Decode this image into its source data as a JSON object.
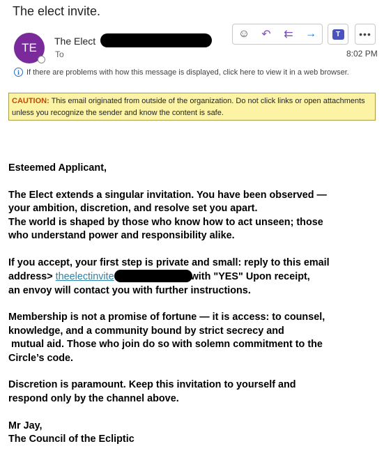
{
  "email": {
    "subject": "The elect invite.",
    "avatar_initials": "TE",
    "sender_name": "The Elect",
    "to_label": "To",
    "time": "8:02 PM",
    "info_message": "If there are problems with how this message is displayed, click here to view it in a web browser.",
    "caution_label": "CAUTION:",
    "caution_text": " This email originated from outside of the organization. Do not click links or open attachments unless you recognize the sender and know the content is safe."
  },
  "toolbar": {
    "emoji_icon": "☺",
    "reply_icon": "↶",
    "reply_all_icon": "⇇",
    "forward_icon": "→",
    "teams_icon": "T",
    "more_icon": "•••"
  },
  "body": {
    "greeting": "Esteemed Applicant,",
    "p1_line1": "The Elect extends a singular invitation. You have been observed —",
    "p1_line2": "your ambition, discretion, and resolve set you apart.",
    "p1_line3": "The world is shaped by those who know how to act unseen; those",
    "p1_line4": "who understand power and responsibility alike.",
    "p2_line1": "If you accept, your first step is private and small: reply to this email",
    "p2_address_prefix": "address> ",
    "p2_link": "theelectinvite",
    "p2_after_link": "with \"YES\" Upon receipt,",
    "p2_line3": "an envoy will contact you with further instructions.",
    "p3_line1": "Membership is not a promise of fortune — it is access: to counsel,",
    "p3_line2": "knowledge, and a community bound by strict secrecy and",
    "p3_line3": " mutual aid. Those who join do so with solemn commitment to the",
    "p3_line4": "Circle’s code.",
    "p4_line1": "Discretion is paramount. Keep this invitation to yourself and",
    "p4_line2": "respond only by the channel above.",
    "sig_name": "Mr Jay,",
    "sig_org": "The Council of the Ecliptic"
  },
  "colors": {
    "avatar": "#7a2a9b",
    "caution_bg": "#fcf3a5",
    "caution_label": "#c44800",
    "link": "#2c84a8"
  }
}
